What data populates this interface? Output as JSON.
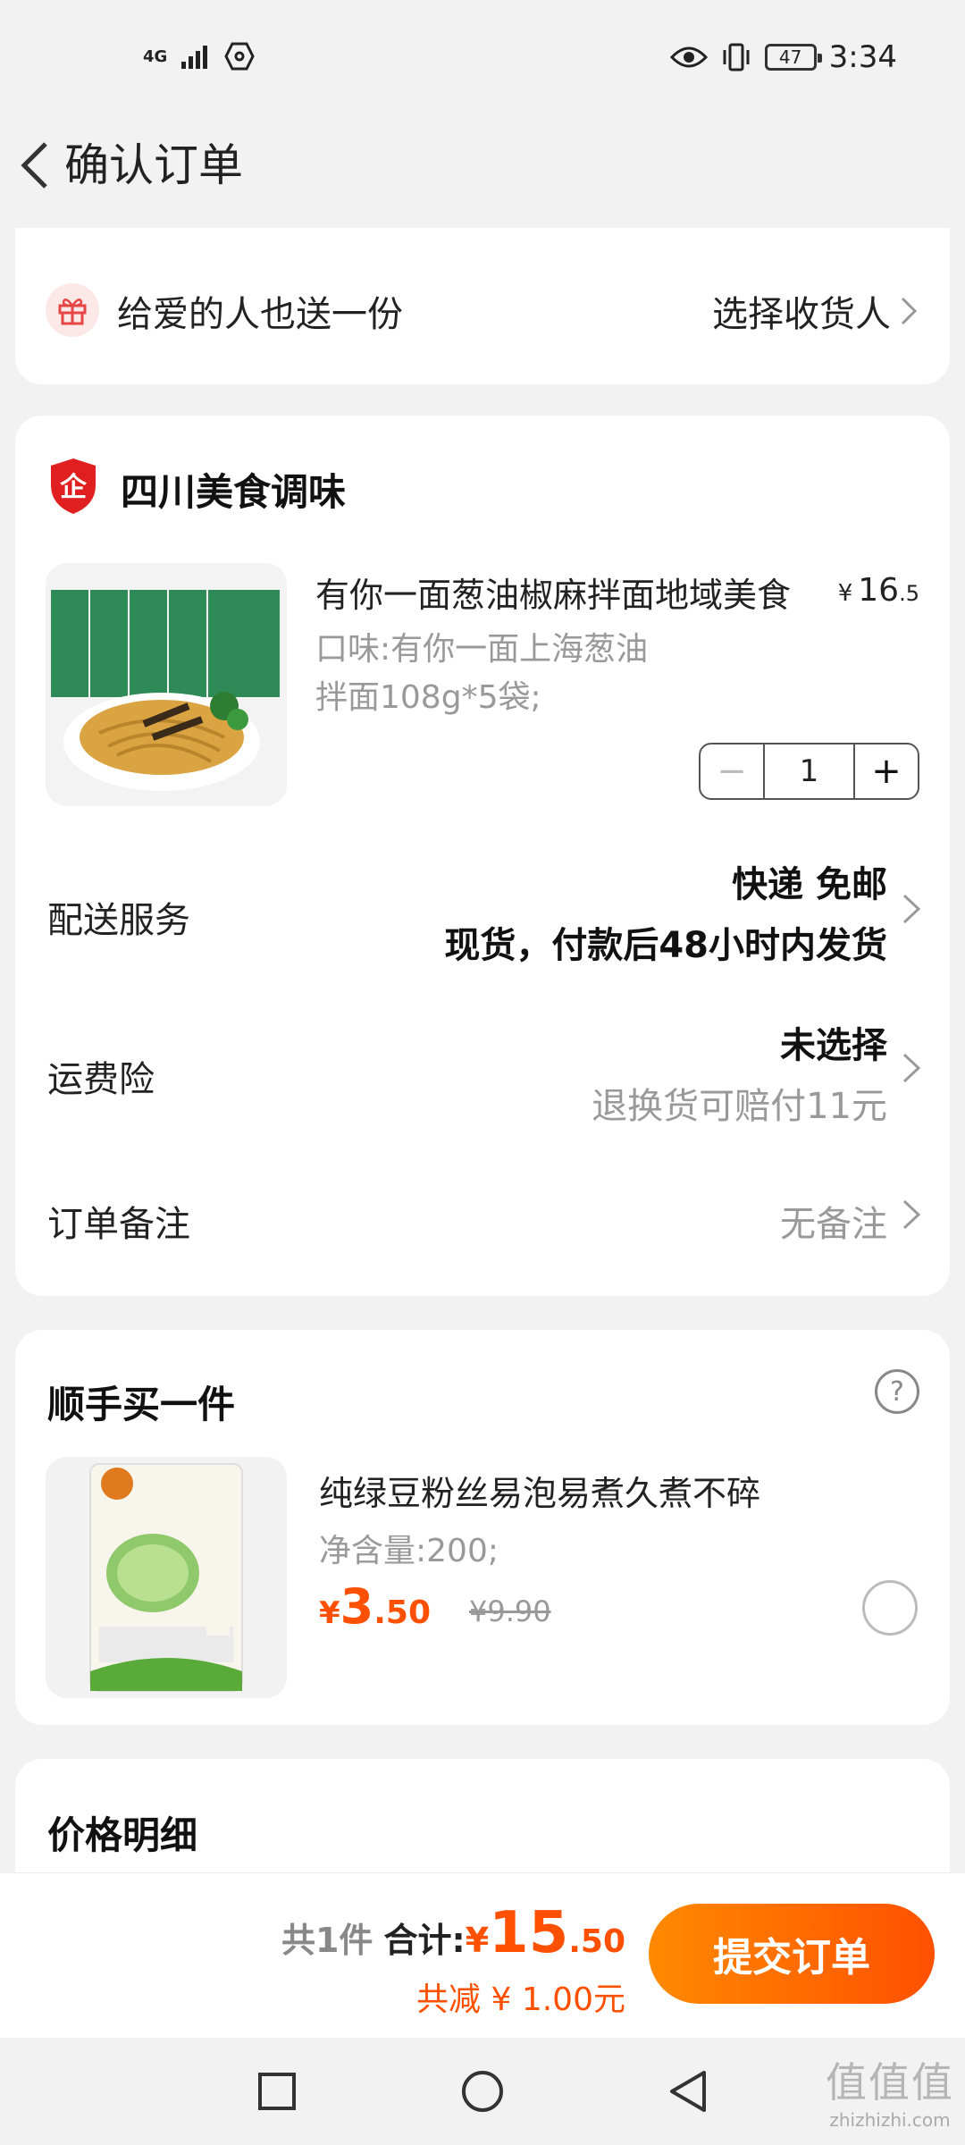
{
  "status_bar": {
    "network": "4G",
    "battery": "47",
    "time": "3:34"
  },
  "header": {
    "title": "确认订单"
  },
  "gift": {
    "label": "给爱的人也送一份",
    "action": "选择收货人"
  },
  "shop": {
    "name": "四川美食调味"
  },
  "product": {
    "title": "有你一面葱油椒麻拌面地域美食",
    "price_symbol": "¥",
    "price_int": "16",
    "price_cents": ".5",
    "spec": "口味:有你一面上海葱油拌面108g*5袋;",
    "qty": "1",
    "minus": "−",
    "plus": "+"
  },
  "delivery": {
    "label": "配送服务",
    "line1": "快递 免邮",
    "line2": "现货，付款后48小时内发货"
  },
  "insurance": {
    "label": "运费险",
    "line1": "未选择",
    "line2": "退换货可赔付11元"
  },
  "remark": {
    "label": "订单备注",
    "value": "无备注"
  },
  "addon": {
    "title": "顺手买一件",
    "help": "?",
    "name": "纯绿豆粉丝易泡易煮久煮不碎",
    "spec": "净含量:200;",
    "price_symbol": "¥",
    "price_int": "3",
    "price_cents": ".50",
    "old_price": "¥9.90"
  },
  "price_detail": {
    "title": "价格明细"
  },
  "bottom": {
    "count": "共1件",
    "total_label": "合计:",
    "total_symbol": "¥",
    "total_int": "15",
    "total_cents": ".50",
    "discount": "共减 ¥ 1.00元",
    "submit": "提交订单"
  },
  "watermark": {
    "top": "值值值",
    "bottom": "zhizhizhi.com"
  },
  "colors": {
    "accent": "#ff5000",
    "accent_start": "#ff8a00",
    "shop_badge": "#e02020"
  }
}
